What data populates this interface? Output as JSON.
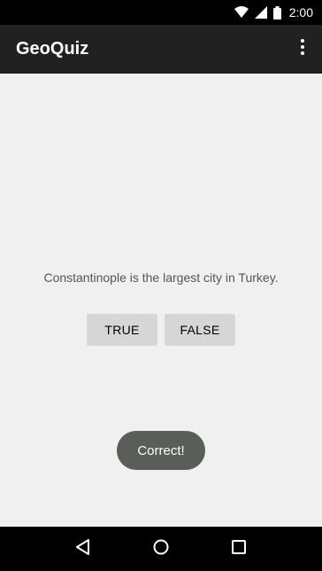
{
  "status_bar": {
    "time": "2:00",
    "icons": [
      "wifi-icon",
      "cell-signal-icon",
      "battery-icon"
    ]
  },
  "app_bar": {
    "title": "GeoQuiz",
    "overflow_icon": "more-vert-icon"
  },
  "main": {
    "question": "Constantinople is the largest city in Turkey.",
    "true_label": "TRUE",
    "false_label": "FALSE"
  },
  "toast": {
    "message": "Correct!"
  },
  "nav_bar": {
    "icons": [
      "back-icon",
      "home-icon",
      "recents-icon"
    ]
  },
  "colors": {
    "app_bar": "#212121",
    "background": "#f0f0f0",
    "button": "#d6d6d6",
    "toast": "#5a5e58"
  }
}
